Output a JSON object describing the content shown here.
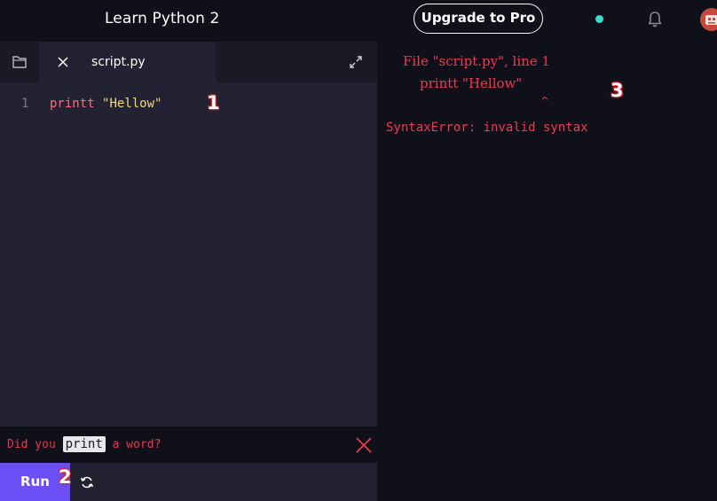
{
  "header": {
    "app_title": "Learn Python 2",
    "upgrade_label": "Upgrade to Pro",
    "status_color": "#3dd9c9",
    "bell_icon": "bell-icon",
    "avatar_icon": "avatar-icon"
  },
  "editor": {
    "tab_label": "script.py",
    "line_number": "1",
    "code_keyword": "printt",
    "code_string": "\"Hellow\""
  },
  "hint": {
    "prefix": "Did you ",
    "word": "print",
    "suffix": " a word?"
  },
  "run": {
    "label": "Run"
  },
  "output": {
    "lines": [
      "File \"script.py\", line 1",
      "printt \"Hellow\"",
      "^",
      "SyntaxError: invalid syntax"
    ]
  },
  "annotations": {
    "m1": "1",
    "m2": "2",
    "m3": "3"
  },
  "colors": {
    "accent": "#6c4ff5",
    "error": "#f0394c",
    "keyword": "#ff6a7a",
    "string": "#f5d77a"
  }
}
